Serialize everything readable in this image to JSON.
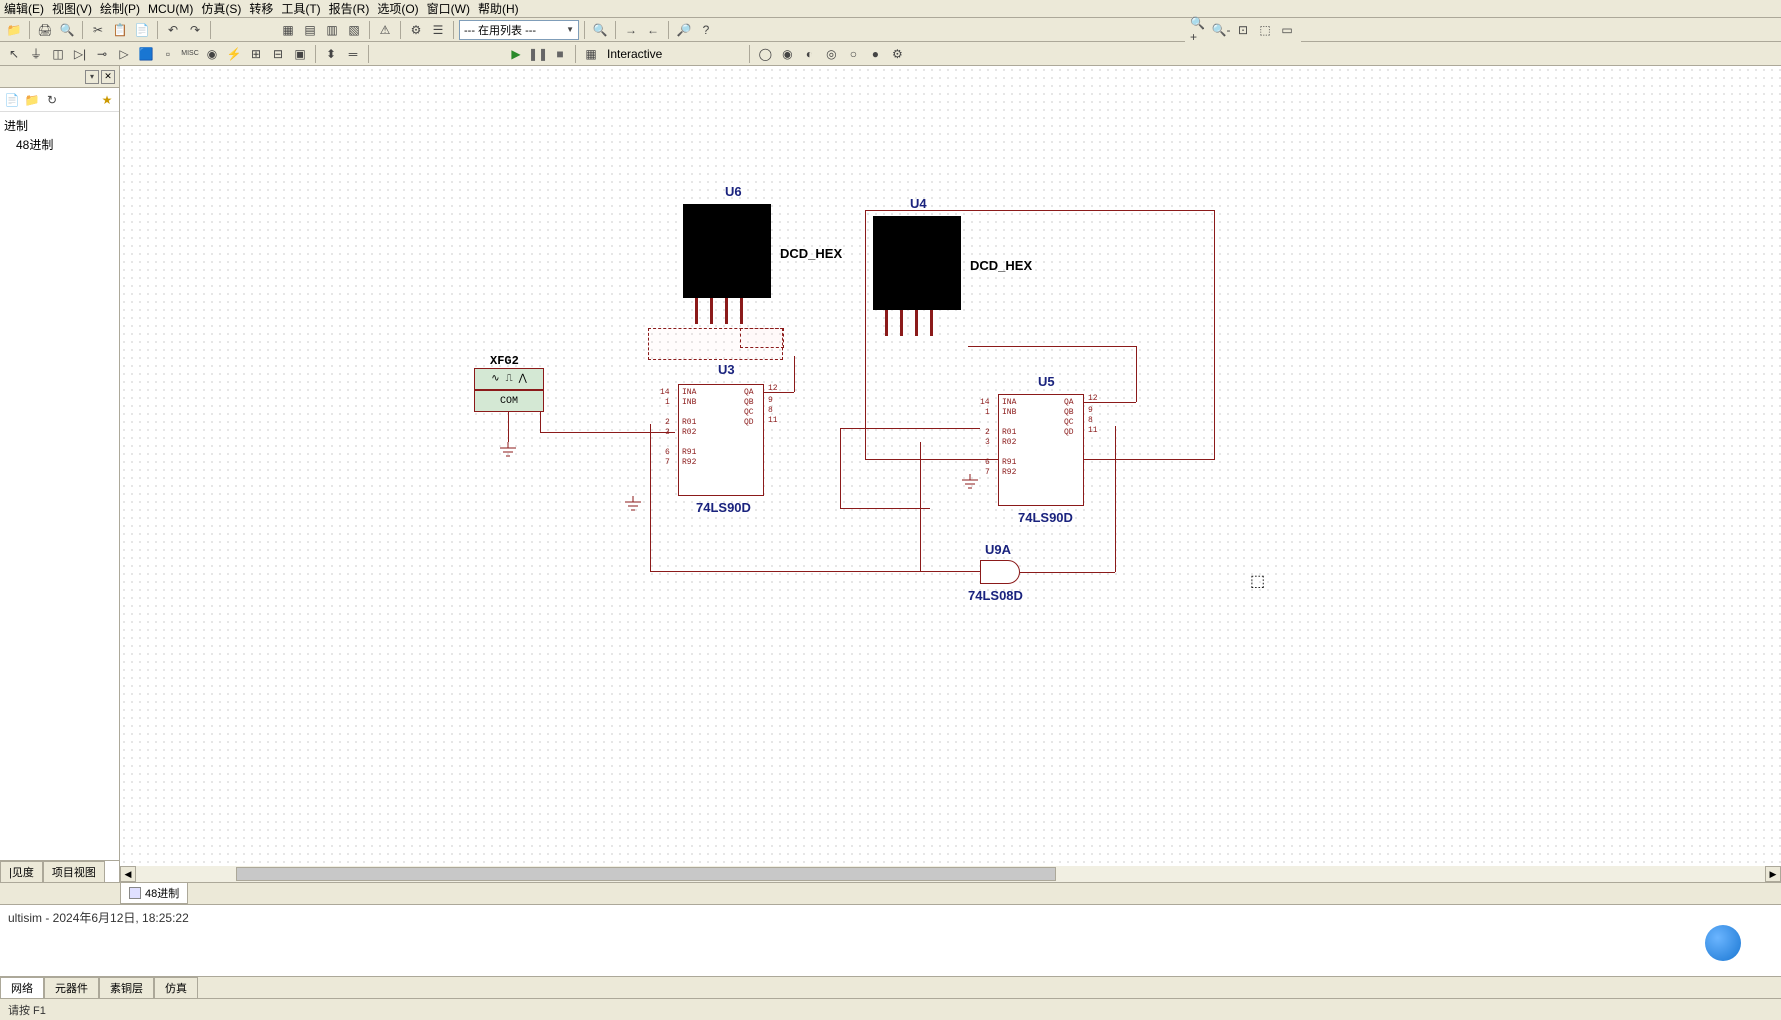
{
  "menu": {
    "items": [
      "编辑(E)",
      "视图(V)",
      "绘制(P)",
      "MCU(M)",
      "仿真(S)",
      "转移",
      "工具(T)",
      "报告(R)",
      "选项(O)",
      "窗口(W)",
      "帮助(H)"
    ]
  },
  "toolbar1": {
    "combo_label": "--- 在用列表 ---"
  },
  "toolbar2": {
    "interactive_label": "Interactive"
  },
  "sidebar": {
    "tree": {
      "root": "进制",
      "child": "48进制"
    },
    "tabs": [
      "|见度",
      "项目视图"
    ]
  },
  "sheet": {
    "tab_label": "48进制"
  },
  "canvas": {
    "components": {
      "u6": {
        "ref": "U6",
        "type": "DCD_HEX"
      },
      "u4": {
        "ref": "U4",
        "type": "DCD_HEX"
      },
      "u3": {
        "ref": "U3",
        "type": "74LS90D"
      },
      "u5": {
        "ref": "U5",
        "type": "74LS90D"
      },
      "u9a": {
        "ref": "U9A",
        "type": "74LS08D"
      },
      "xfg2": {
        "ref": "XFG2",
        "label": "COM"
      }
    },
    "ic_pins": {
      "left": {
        "l1": "INA",
        "l2": "INB",
        "l3": "R01",
        "l4": "R02",
        "l5": "R91",
        "l6": "R92"
      },
      "right": {
        "r1": "QA",
        "r2": "QB",
        "r3": "QC",
        "r4": "QD"
      },
      "nums_left": [
        "14",
        "1",
        "2",
        "3",
        "6",
        "7"
      ],
      "nums_right": [
        "12",
        "9",
        "8",
        "11"
      ]
    }
  },
  "bottom": {
    "log": "ultisim  -  2024年6月12日, 18:25:22",
    "tabs": [
      "网络",
      "元器件",
      "素铜层",
      "仿真"
    ]
  },
  "status": {
    "text": "请按 F1"
  }
}
